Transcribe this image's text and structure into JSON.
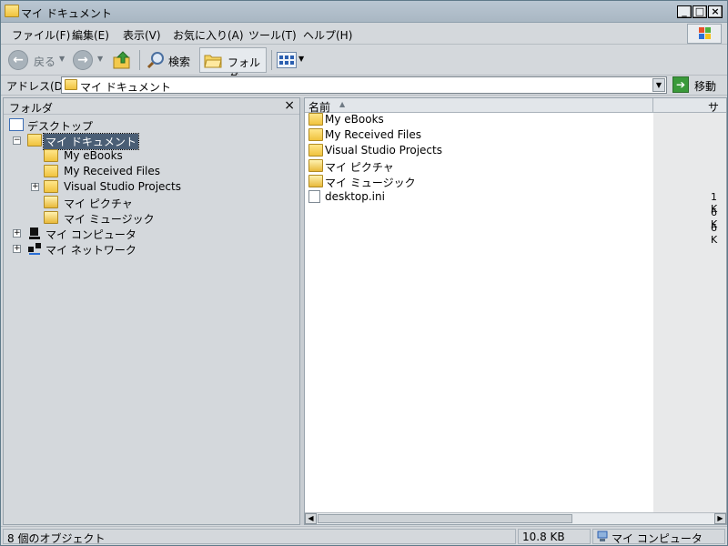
{
  "window": {
    "title": "マイ ドキュメント",
    "controls": [
      "_",
      "□",
      "×"
    ]
  },
  "menu": {
    "items": [
      "ファイル(F)",
      "編集(E)",
      "表示(V)",
      "お気に入り(A)",
      "ツール(T)",
      "ヘルプ(H)"
    ]
  },
  "toolbar": {
    "back_label": "戻る",
    "search_label": "検索",
    "folders_label": "フォルダ"
  },
  "address": {
    "label": "アドレス(D)",
    "value": "マイ ドキュメント",
    "go_label": "移動"
  },
  "folder_pane": {
    "title": "フォルダ",
    "close": "×",
    "tree": [
      {
        "label": "デスクトップ",
        "icon": "desktop-icon"
      },
      {
        "label": "マイ ドキュメント",
        "icon": "my-documents-icon",
        "selected": true
      },
      {
        "label": "My eBooks",
        "icon": "folder-icon"
      },
      {
        "label": "My Received Files",
        "icon": "folder-icon"
      },
      {
        "label": "Visual Studio Projects",
        "icon": "folder-icon"
      },
      {
        "label": "マイ ピクチャ",
        "icon": "my-pictures-icon"
      },
      {
        "label": "マイ ミュージック",
        "icon": "my-music-icon"
      },
      {
        "label": "マイ コンピュータ",
        "icon": "my-computer-icon"
      },
      {
        "label": "マイ ネットワーク",
        "icon": "my-network-icon"
      }
    ]
  },
  "list": {
    "columns": [
      "名前",
      "サイ"
    ],
    "files": [
      {
        "name": "My eBooks",
        "icon": "folder-icon"
      },
      {
        "name": "My Received Files",
        "icon": "folder-icon"
      },
      {
        "name": "Visual Studio Projects",
        "icon": "folder-icon"
      },
      {
        "name": "マイ ピクチャ",
        "icon": "my-pictures-icon"
      },
      {
        "name": "マイ ミュージック",
        "icon": "my-music-icon"
      },
      {
        "name": "desktop.ini",
        "icon": "ini-file-icon"
      }
    ],
    "sizes": [
      "1 K",
      "6 K",
      "6 K"
    ]
  },
  "status": {
    "objects": "8 個のオブジェクト",
    "size": "10.8 KB",
    "zone": "マイ コンピュータ"
  }
}
